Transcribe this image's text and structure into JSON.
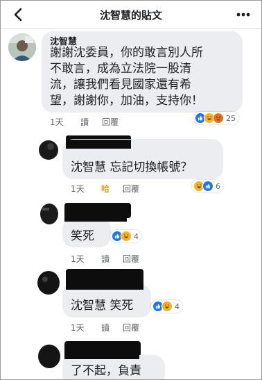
{
  "header": {
    "title": "沈智慧的貼文",
    "back_icon": "chevron-left-icon",
    "more_icon": "more-dots-icon"
  },
  "comments": [
    {
      "name": "沈智慧",
      "lines": [
        "謝謝沈委員，你的敢言別人所",
        "不敢言，成為立法院一股清",
        "流，讓我們看見國家還有希",
        "望，謝謝你，加油，支持你！"
      ],
      "time": "1天",
      "read": "讀",
      "reply": "回覆",
      "reactions": [
        "like",
        "haha",
        "angry"
      ],
      "reaction_count": "25"
    },
    {
      "text": "沈智慧 忘記切換帳號？",
      "time": "1天",
      "haha": "哈",
      "reply": "回覆",
      "reactions": [
        "haha",
        "like"
      ],
      "reaction_count": "6"
    },
    {
      "text": "笑死",
      "time": "1天",
      "read": "讀",
      "reply": "回覆",
      "reactions": [
        "like",
        "haha"
      ],
      "reaction_count": "4"
    },
    {
      "text": "沈智慧 笑死",
      "time": "1天",
      "read": "讀",
      "reply": "回覆",
      "reactions": [
        "like",
        "haha"
      ],
      "reaction_count": "4"
    },
    {
      "text": "了不起，負責"
    }
  ],
  "colors": {
    "like": "#1877f2",
    "haha": "#f7b125",
    "angry": "#e9710f",
    "haha_text": "#e7a11a",
    "bubble": "#ebedf0"
  }
}
